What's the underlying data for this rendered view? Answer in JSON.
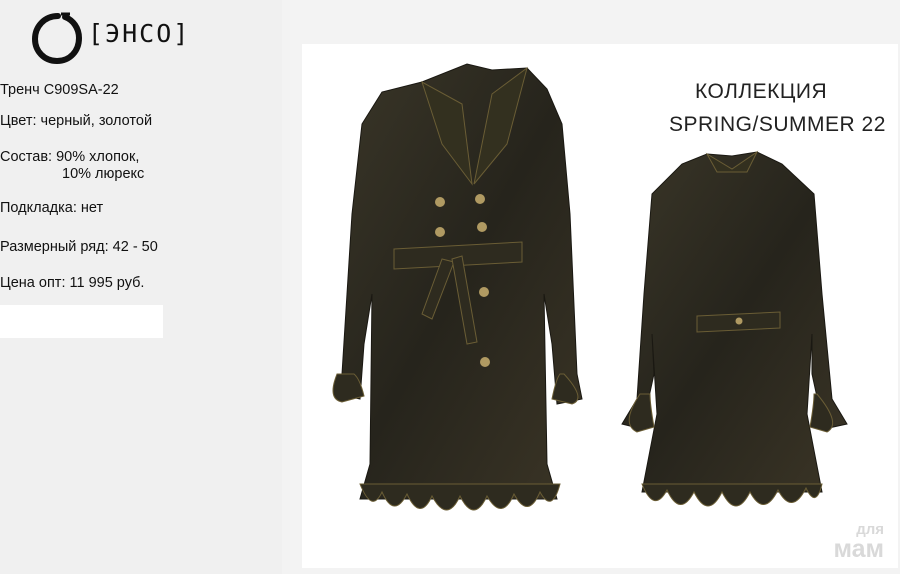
{
  "brand": {
    "logo_text": "[ЭНСО]"
  },
  "product": {
    "name": "Тренч C909SA-22",
    "color": "Цвет: черный, золотой",
    "composition_line1": "Состав: 90% хлопок,",
    "composition_line2": "10% люрекс",
    "lining": "Подкладка: нет",
    "sizes": "Размерный ряд: 42 - 50",
    "price": "Цена опт: 11 995 руб."
  },
  "collection": {
    "line1": "КОЛЛЕКЦИЯ",
    "line2": "SPRING/SUMMER 22"
  },
  "watermark": {
    "line1": "для",
    "line2": "мам"
  },
  "colors": {
    "coat": "#2c2a22",
    "gold": "#7a6a3a",
    "panel": "#f0f0f0"
  }
}
